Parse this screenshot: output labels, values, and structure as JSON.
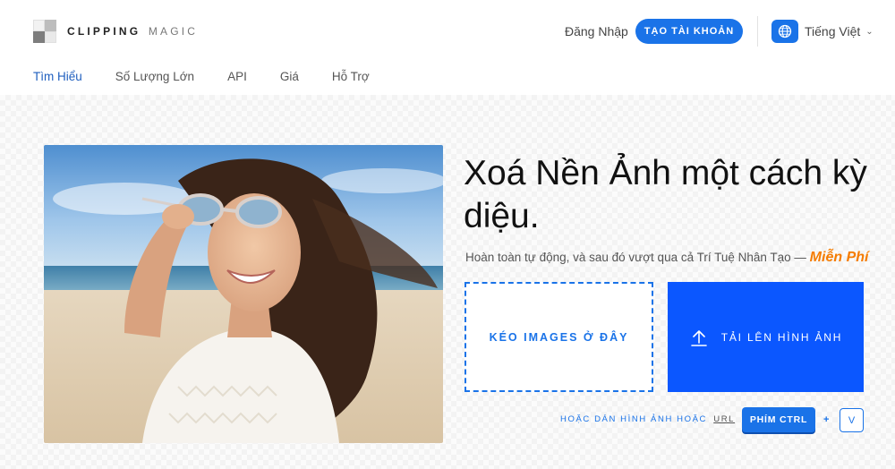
{
  "header": {
    "logo_word1": "CLIPPING",
    "logo_word2": "MAGIC",
    "login_label": "Đăng Nhập",
    "signup_label": "TẠO TÀI KHOẢN",
    "language_label": "Tiếng Việt",
    "language_icon": "globe-icon"
  },
  "nav": {
    "items": [
      {
        "label": "Tìm Hiểu",
        "active": true
      },
      {
        "label": "Số Lượng Lớn",
        "active": false
      },
      {
        "label": "API",
        "active": false
      },
      {
        "label": "Giá",
        "active": false
      },
      {
        "label": "Hỗ Trợ",
        "active": false
      }
    ]
  },
  "hero": {
    "headline": "Xoá Nền Ảnh một cách kỳ diệu.",
    "subline": "Hoàn toàn tự động, và sau đó vượt qua cả Trí Tuệ Nhân Tạo —",
    "free_label": "Miễn Phí",
    "drop_label": "KÉO IMAGES Ở ĐÂY",
    "upload_label": "TẢI LÊN HÌNH ẢNH",
    "upload_icon": "upload-icon",
    "paste_label": "HOẶC DÁN HÌNH ẢNH HOẶC",
    "url_label": "URL",
    "ctrl_label": "PHÍM CTRL",
    "plus_label": "+",
    "v_label": "V"
  },
  "colors": {
    "accent": "#1a73e8",
    "upload_bg": "#0b57ff",
    "free_color": "#f57c00"
  }
}
